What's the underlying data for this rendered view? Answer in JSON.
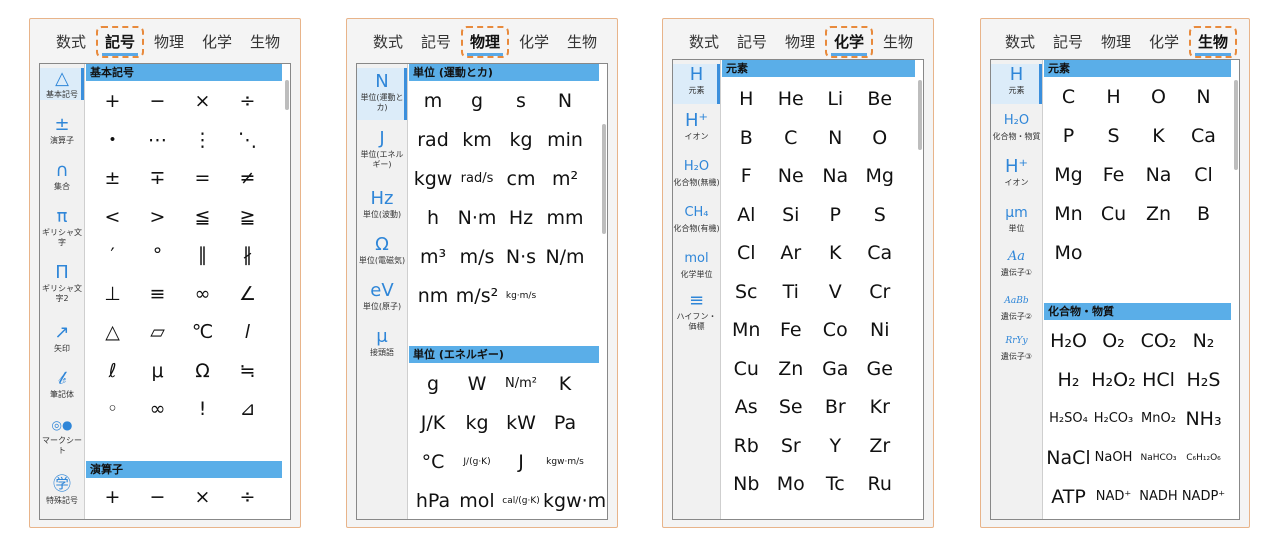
{
  "tabs": [
    "数式",
    "記号",
    "物理",
    "化学",
    "生物"
  ],
  "panels": [
    {
      "active_tab": 1,
      "categories": [
        {
          "icon": "△",
          "label": "基本記号"
        },
        {
          "icon": "±",
          "label": "演算子"
        },
        {
          "icon": "∩",
          "label": "集合"
        },
        {
          "icon": "π",
          "label": "ギリシャ文字"
        },
        {
          "icon": "Π",
          "label": "ギリシャ文字2"
        },
        {
          "icon": "↗",
          "label": "矢印"
        },
        {
          "icon": "𝒷",
          "label": "筆記体"
        },
        {
          "icon": "◎●",
          "label": "マークシート"
        },
        {
          "icon": "㊫",
          "label": "特殊記号"
        }
      ],
      "sections": [
        {
          "title": "基本記号",
          "keys": [
            "+",
            "−",
            "×",
            "÷",
            "・",
            "⋯",
            "⋮",
            "⋱",
            "±",
            "∓",
            "=",
            "≠",
            "<",
            ">",
            "≦",
            "≧",
            "′",
            "°",
            "∥",
            "∦",
            "⊥",
            "≡",
            "∞",
            "∠",
            "△",
            "▱",
            "℃",
            "𝑙",
            "ℓ",
            "μ",
            "Ω",
            "≒",
            "◦",
            "∞",
            "!",
            "⊿"
          ]
        },
        {
          "title": "演算子",
          "keys": [
            "+",
            "−",
            "×",
            "÷"
          ]
        }
      ]
    },
    {
      "active_tab": 2,
      "categories": [
        {
          "icon": "N",
          "label": "単位(運動とカ)"
        },
        {
          "icon": "J",
          "label": "単位(エネルギー)"
        },
        {
          "icon": "Hz",
          "label": "単位(波動)"
        },
        {
          "icon": "Ω",
          "label": "単位(電磁気)"
        },
        {
          "icon": "eV",
          "label": "単位(原子)"
        },
        {
          "icon": "μ",
          "label": "接頭語"
        }
      ],
      "sections": [
        {
          "title": "単位 (運動とカ)",
          "keys": [
            "m",
            "g",
            "s",
            "N",
            "rad",
            "km",
            "kg",
            "min",
            "kgw",
            "rad/s",
            "cm",
            "m²",
            "h",
            "N·m",
            "Hz",
            "mm",
            "m³",
            "m/s",
            "N·s",
            "N/m",
            "nm",
            "m/s²",
            "kg·m/s"
          ]
        },
        {
          "title": "単位 (エネルギー)",
          "keys": [
            "g",
            "W",
            "N/m²",
            "K",
            "J/K",
            "kg",
            "kW",
            "Pa",
            "°C",
            "J/(g·K)",
            "J",
            "kgw·m/s",
            "hPa",
            "mol",
            "cal/(g·K)",
            "kgw·m"
          ]
        }
      ]
    },
    {
      "active_tab": 3,
      "categories": [
        {
          "icon": "H",
          "label": "元素"
        },
        {
          "icon": "H⁺",
          "label": "イオン"
        },
        {
          "icon": "H₂O",
          "label": "化合物(無機)"
        },
        {
          "icon": "CH₄",
          "label": "化合物(有機)"
        },
        {
          "icon": "mol",
          "label": "化学単位"
        },
        {
          "icon": "≡",
          "label": "ハイフン・価標"
        }
      ],
      "sections": [
        {
          "title": "元素",
          "keys": [
            "H",
            "He",
            "Li",
            "Be",
            "B",
            "C",
            "N",
            "O",
            "F",
            "Ne",
            "Na",
            "Mg",
            "Al",
            "Si",
            "P",
            "S",
            "Cl",
            "Ar",
            "K",
            "Ca",
            "Sc",
            "Ti",
            "V",
            "Cr",
            "Mn",
            "Fe",
            "Co",
            "Ni",
            "Cu",
            "Zn",
            "Ga",
            "Ge",
            "As",
            "Se",
            "Br",
            "Kr",
            "Rb",
            "Sr",
            "Y",
            "Zr",
            "Nb",
            "Mo",
            "Tc",
            "Ru"
          ]
        }
      ]
    },
    {
      "active_tab": 4,
      "categories": [
        {
          "icon": "H",
          "label": "元素"
        },
        {
          "icon": "H₂O",
          "label": "化合物・物質"
        },
        {
          "icon": "H⁺",
          "label": "イオン"
        },
        {
          "icon": "μm",
          "label": "単位"
        },
        {
          "icon": "Aa",
          "label": "遺伝子①"
        },
        {
          "icon": "AaBb",
          "label": "遺伝子②"
        },
        {
          "icon": "RrYy",
          "label": "遺伝子③"
        }
      ],
      "sections": [
        {
          "title": "元素",
          "keys": [
            "C",
            "H",
            "O",
            "N",
            "P",
            "S",
            "K",
            "Ca",
            "Mg",
            "Fe",
            "Na",
            "Cl",
            "Mn",
            "Cu",
            "Zn",
            "B",
            "Mo"
          ]
        },
        {
          "title": "化合物・物質",
          "keys": [
            "H₂O",
            "O₂",
            "CO₂",
            "N₂",
            "H₂",
            "H₂O₂",
            "HCl",
            "H₂S",
            "H₂SO₄",
            "H₂CO₃",
            "MnO₂",
            "NH₃",
            "NaCl",
            "NaOH",
            "NaHCO₃",
            "C₆H₁₂O₆",
            "ATP",
            "NAD⁺",
            "NADH",
            "NADP⁺"
          ]
        }
      ]
    }
  ]
}
